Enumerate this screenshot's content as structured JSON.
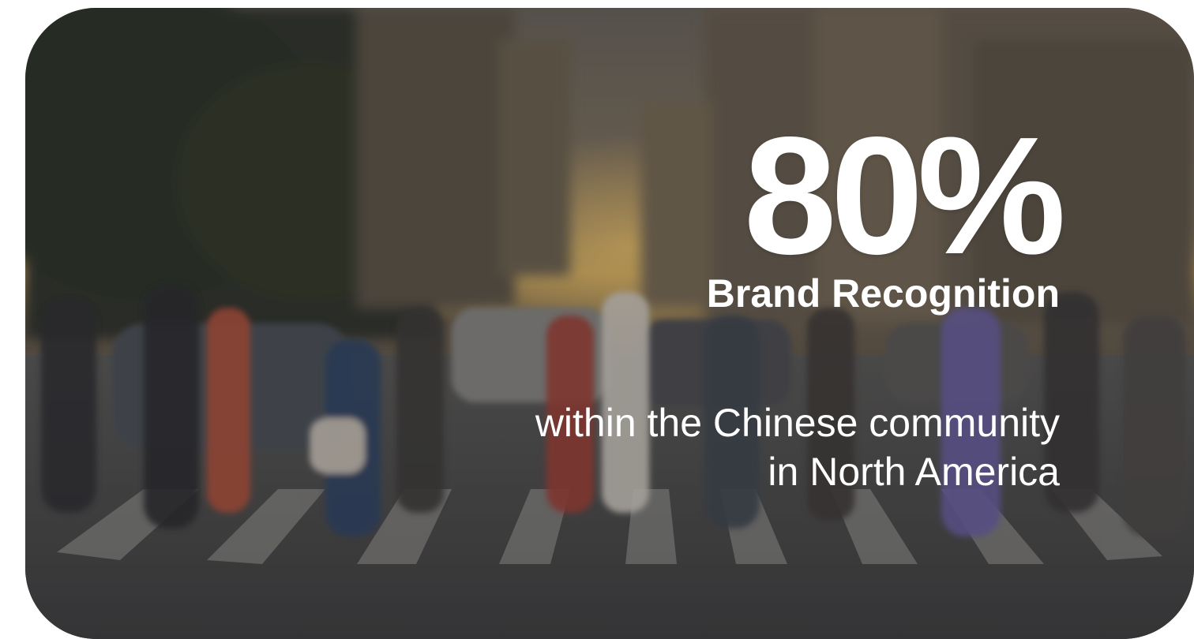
{
  "hero": {
    "background": "blurred-city-crosswalk-photo",
    "stat_value": "80%",
    "stat_label": "Brand Recognition",
    "description_line1": "within the Chinese community",
    "description_line2": "in North America",
    "text_color": "#ffffff"
  }
}
